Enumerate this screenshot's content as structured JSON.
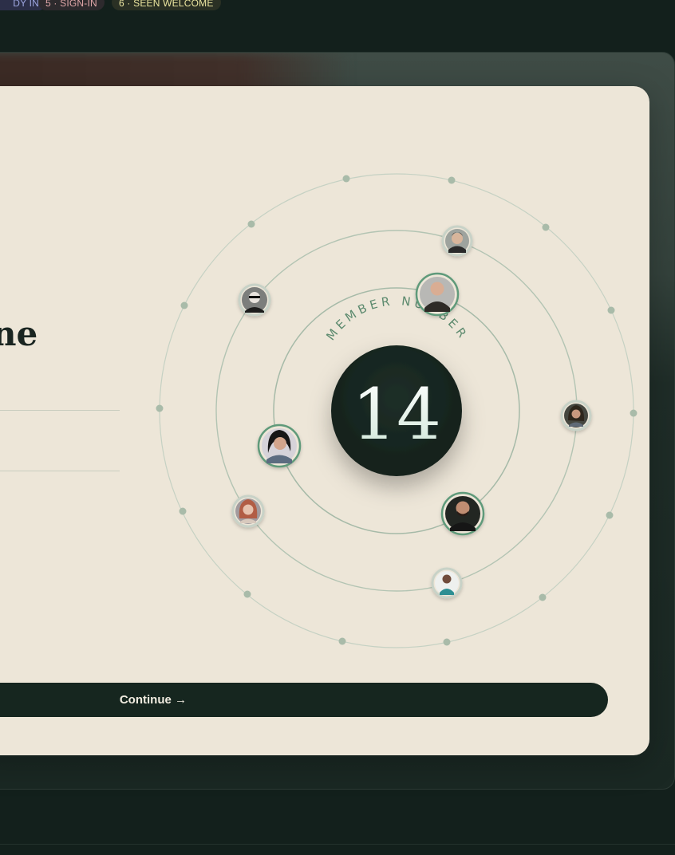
{
  "badges": [
    {
      "label": "DY IN"
    },
    {
      "label": "5 · SIGN-IN"
    },
    {
      "label": "6 · SEEN WELCOME"
    }
  ],
  "headline_fragment": "ne",
  "member": {
    "arc_label": "MEMBER NUMBER",
    "number": "14"
  },
  "continue_label": "Continue →",
  "colors": {
    "card_bg": "#ede6d8",
    "dark_green": "#16261f",
    "orbit_line": "#b7c8b8",
    "orbit_dot": "#a9bba9",
    "accent_green": "#5f9a7a"
  },
  "avatars": [
    {
      "name": "avatar-curly-hair-man",
      "ring": "inner"
    },
    {
      "name": "avatar-bald-man",
      "ring": "inner"
    },
    {
      "name": "avatar-glasses-man",
      "ring": "middle"
    },
    {
      "name": "avatar-woman-dark-hair",
      "ring": "outer"
    },
    {
      "name": "avatar-woman-smiling",
      "ring": "inner"
    },
    {
      "name": "avatar-woman-redhead",
      "ring": "middle"
    },
    {
      "name": "avatar-man-beard",
      "ring": "inner"
    },
    {
      "name": "avatar-man-teal-shirt",
      "ring": "middle"
    }
  ]
}
